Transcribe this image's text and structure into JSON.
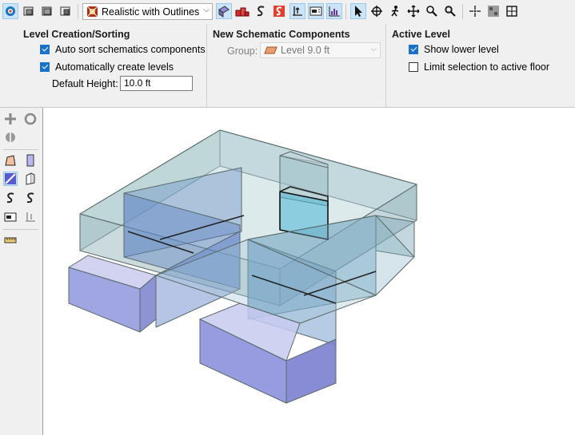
{
  "toolbar": {
    "render_mode": "Realistic with Outlines",
    "icons": [
      "view-mode-icon",
      "view-box-1-icon",
      "view-box-2-icon",
      "view-box-3-icon",
      "render-mode-icon",
      "blocks-icon",
      "schematic-s-icon",
      "schematic-s-red-icon",
      "dimension-icon",
      "text-box-icon",
      "chart-icon",
      "select-arrow-icon",
      "orbit-icon",
      "walk-icon",
      "pan-icon",
      "zoom-icon",
      "zoom-window-icon",
      "snap-icon",
      "grid-icon",
      "fit-icon"
    ]
  },
  "level_creation": {
    "title": "Level Creation/Sorting",
    "auto_sort_label": "Auto sort schematics components",
    "auto_sort_checked": true,
    "auto_create_label": "Automatically create levels",
    "auto_create_checked": true,
    "default_height_label": "Default Height:",
    "default_height_value": "10.0 ft"
  },
  "new_schematic": {
    "title": "New Schematic Components",
    "group_label": "Group:",
    "group_value": "Level 9.0 ft"
  },
  "active_level": {
    "title": "Active Level",
    "show_lower_label": "Show lower level",
    "show_lower_checked": true,
    "limit_selection_label": "Limit selection to active floor",
    "limit_selection_checked": false
  },
  "colors": {
    "accent": "#1a73c8",
    "active_tool_bg": "#cce4f7",
    "glass_fill": "#7fb0c8",
    "lower_fill": "#8a8ee0"
  }
}
